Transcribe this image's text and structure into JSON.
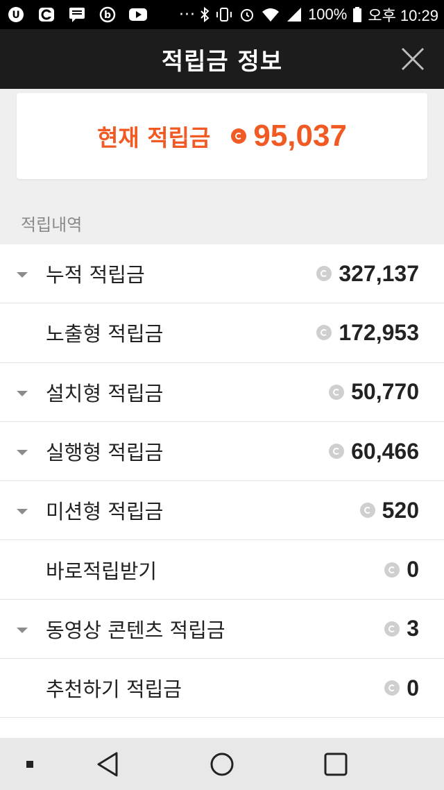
{
  "status_bar": {
    "battery_text": "100%",
    "time_text": "오후 10:29",
    "dots": "···"
  },
  "header": {
    "title": "적립금 정보"
  },
  "current": {
    "label": "현재 적립금",
    "value": "95,037"
  },
  "section": {
    "title": "적립내역"
  },
  "rows": [
    {
      "label": "누적 적립금",
      "value": "327,137",
      "expandable": true
    },
    {
      "label": "노출형 적립금",
      "value": "172,953",
      "expandable": false
    },
    {
      "label": "설치형 적립금",
      "value": "50,770",
      "expandable": true
    },
    {
      "label": "실행형 적립금",
      "value": "60,466",
      "expandable": true
    },
    {
      "label": "미션형 적립금",
      "value": "520",
      "expandable": true
    },
    {
      "label": "바로적립받기",
      "value": "0",
      "expandable": false
    },
    {
      "label": "동영상 콘텐츠 적립금",
      "value": "3",
      "expandable": true
    },
    {
      "label": "추천하기 적립금",
      "value": "0",
      "expandable": false
    }
  ],
  "colors": {
    "accent": "#f15a22",
    "header_bg": "#1c1c1c",
    "page_bg": "#efefef"
  },
  "icons": {
    "close": "close-icon",
    "coin": "coin-icon",
    "caret": "caret-down-icon",
    "nav_back": "back-triangle-icon",
    "nav_home": "home-circle-icon",
    "nav_recent": "recent-square-icon"
  }
}
